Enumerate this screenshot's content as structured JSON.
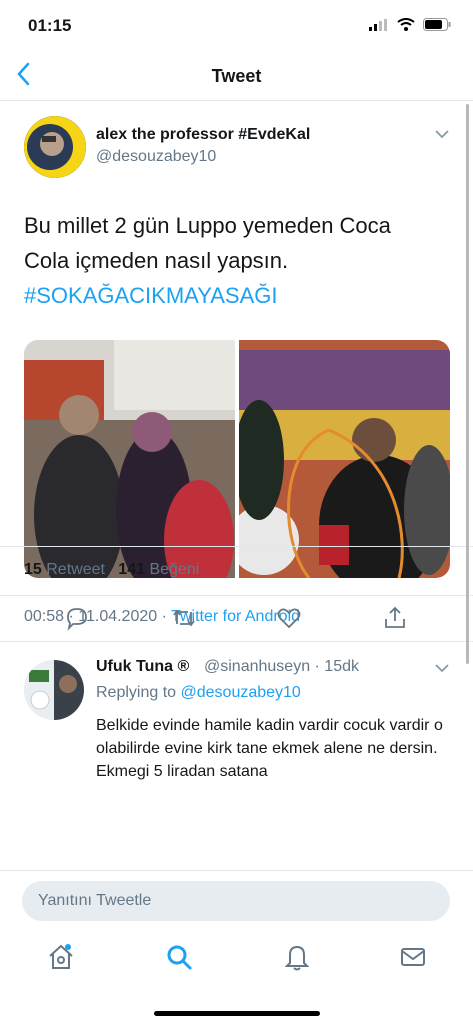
{
  "status": {
    "time": "01:15"
  },
  "nav": {
    "title": "Tweet"
  },
  "tweet": {
    "author": "alex the professor #EvdeKal",
    "handle": "@desouzabey10",
    "text_line1": "Bu millet 2 gün Luppo yemeden Coca",
    "text_line2": "Cola içmeden nasıl yapsın.",
    "hashtag": "#SOKAĞACIKMAYASAĞI",
    "timestamp": "00:58 · 11.04.2020 · ",
    "source": "Twitter for Android",
    "retweets": "15",
    "retweets_label": "Retweet",
    "likes": "141",
    "likes_label": "Beğeni"
  },
  "reply": {
    "name": "Ufuk Tuna ®",
    "handle": "@sinanhuseyn · 15dk",
    "replying_prefix": "Replying to ",
    "replying_to": "@desouzabey10",
    "text": "Belkide evinde hamile kadin vardir cocuk vardir o olabilirde evine kirk tane ekmek alene ne dersin. Ekmegi 5 liradan satana"
  },
  "compose": {
    "placeholder": "Yanıtını Tweetle"
  },
  "icons": [
    "back-icon",
    "reply-icon",
    "retweet-icon",
    "like-icon",
    "share-icon",
    "home-icon",
    "search-icon",
    "notifications-icon",
    "messages-icon"
  ]
}
